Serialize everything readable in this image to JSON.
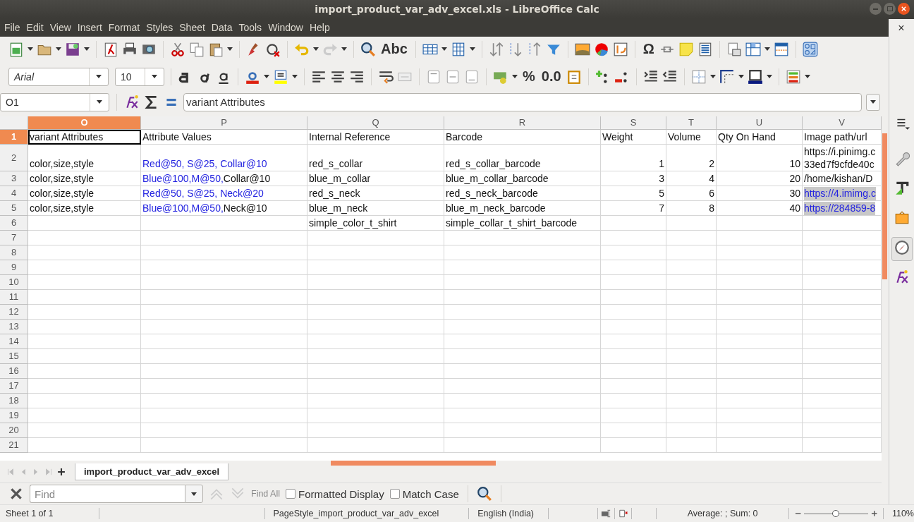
{
  "window": {
    "title": "import_product_var_adv_excel.xls - LibreOffice Calc",
    "doc_close": "×"
  },
  "menu": [
    "File",
    "Edit",
    "View",
    "Insert",
    "Format",
    "Styles",
    "Sheet",
    "Data",
    "Tools",
    "Window",
    "Help"
  ],
  "toolbar": {
    "glyphs": [
      "Abc",
      "Ω",
      "%",
      "0.0"
    ]
  },
  "format_bar": {
    "font_name": "Arial",
    "font_size": "10"
  },
  "formula_bar": {
    "name_box": "O1",
    "value": "variant Attributes"
  },
  "columns": [
    {
      "label": "O",
      "selected": true
    },
    {
      "label": "P",
      "selected": false
    },
    {
      "label": "Q",
      "selected": false
    },
    {
      "label": "R",
      "selected": false
    },
    {
      "label": "S",
      "selected": false
    },
    {
      "label": "T",
      "selected": false
    },
    {
      "label": "U",
      "selected": false
    },
    {
      "label": "V",
      "selected": false
    }
  ],
  "rows": [
    {
      "num": "1",
      "selected": true,
      "cells": [
        {
          "kind": "text",
          "text": "variant Attributes",
          "selected": true
        },
        {
          "kind": "text",
          "text": "Attribute Values"
        },
        {
          "kind": "text",
          "text": "Internal Reference"
        },
        {
          "kind": "text",
          "text": "Barcode"
        },
        {
          "kind": "text",
          "text": "Weight"
        },
        {
          "kind": "text",
          "text": "Volume"
        },
        {
          "kind": "text",
          "text": "Qty On Hand"
        },
        {
          "kind": "text",
          "text": "Image path/url"
        }
      ]
    },
    {
      "num": "2",
      "selected": false,
      "cells": [
        {
          "kind": "text",
          "text": "color,size,style"
        },
        {
          "kind": "rich",
          "parts": [
            {
              "text": "Red@50, S@25, Collar@10",
              "link": true
            }
          ]
        },
        {
          "kind": "text",
          "text": "red_s_collar"
        },
        {
          "kind": "text",
          "text": "red_s_collar_barcode"
        },
        {
          "kind": "number",
          "text": "1"
        },
        {
          "kind": "number",
          "text": "2"
        },
        {
          "kind": "number",
          "text": "10"
        },
        {
          "kind": "wrap",
          "lines": [
            "https://i.pinimg.c",
            "33ed7f9cfde40c"
          ]
        }
      ]
    },
    {
      "num": "3",
      "selected": false,
      "cells": [
        {
          "kind": "text",
          "text": "color,size,style"
        },
        {
          "kind": "rich",
          "parts": [
            {
              "text": "Blue@100,M@50,",
              "link": true
            },
            {
              "text": "Collar@10",
              "link": false
            }
          ]
        },
        {
          "kind": "text",
          "text": "blue_m_collar"
        },
        {
          "kind": "text",
          "text": "blue_m_collar_barcode"
        },
        {
          "kind": "number",
          "text": "3"
        },
        {
          "kind": "number",
          "text": "4"
        },
        {
          "kind": "number",
          "text": "20"
        },
        {
          "kind": "text",
          "text": "/home/kishan/D"
        }
      ]
    },
    {
      "num": "4",
      "selected": false,
      "cells": [
        {
          "kind": "text",
          "text": "color,size,style"
        },
        {
          "kind": "rich",
          "parts": [
            {
              "text": "Red@50, S@25, Neck@20",
              "link": true
            }
          ]
        },
        {
          "kind": "text",
          "text": "red_s_neck"
        },
        {
          "kind": "text",
          "text": "red_s_neck_barcode"
        },
        {
          "kind": "number",
          "text": "5"
        },
        {
          "kind": "number",
          "text": "6"
        },
        {
          "kind": "number",
          "text": "30"
        },
        {
          "kind": "link",
          "text": "https://4.imimg.c",
          "highlighted": true
        }
      ]
    },
    {
      "num": "5",
      "selected": false,
      "cells": [
        {
          "kind": "text",
          "text": "color,size,style"
        },
        {
          "kind": "rich",
          "parts": [
            {
              "text": "Blue@100,M@50,",
              "link": true
            },
            {
              "text": "Neck@10",
              "link": false
            }
          ]
        },
        {
          "kind": "text",
          "text": "blue_m_neck"
        },
        {
          "kind": "text",
          "text": "blue_m_neck_barcode"
        },
        {
          "kind": "number",
          "text": "7"
        },
        {
          "kind": "number",
          "text": "8"
        },
        {
          "kind": "number",
          "text": "40"
        },
        {
          "kind": "link",
          "text": "https://284859-8",
          "highlighted": true
        }
      ]
    },
    {
      "num": "6",
      "selected": false,
      "cells": [
        null,
        null,
        {
          "kind": "text",
          "text": "simple_color_t_shirt"
        },
        {
          "kind": "text",
          "text": "simple_collar_t_shirt_barcode"
        },
        null,
        null,
        null,
        null
      ]
    },
    {
      "num": "7",
      "selected": false
    },
    {
      "num": "8",
      "selected": false
    },
    {
      "num": "9",
      "selected": false
    },
    {
      "num": "10",
      "selected": false
    },
    {
      "num": "11",
      "selected": false
    },
    {
      "num": "12",
      "selected": false
    },
    {
      "num": "13",
      "selected": false
    },
    {
      "num": "14",
      "selected": false
    },
    {
      "num": "15",
      "selected": false
    },
    {
      "num": "16",
      "selected": false
    },
    {
      "num": "17",
      "selected": false
    },
    {
      "num": "18",
      "selected": false
    },
    {
      "num": "19",
      "selected": false
    },
    {
      "num": "20",
      "selected": false
    },
    {
      "num": "21",
      "selected": false
    }
  ],
  "sheet_tabs": [
    {
      "label": "import_product_var_adv_excel",
      "selected": true
    }
  ],
  "find_bar": {
    "placeholder": "Find",
    "find_all": "Find All",
    "find_all_disabled": true,
    "options": [
      {
        "label": "Formatted Display",
        "checked": false
      },
      {
        "label": "Match Case",
        "checked": false
      }
    ]
  },
  "status_bar": {
    "sheet": "Sheet 1 of 1",
    "page_style": "PageStyle_import_product_var_adv_excel",
    "language": "English (India)",
    "summary": "Average: ; Sum: 0",
    "zoom_slider": {
      "level": 0.5
    },
    "zoom": "110%"
  }
}
